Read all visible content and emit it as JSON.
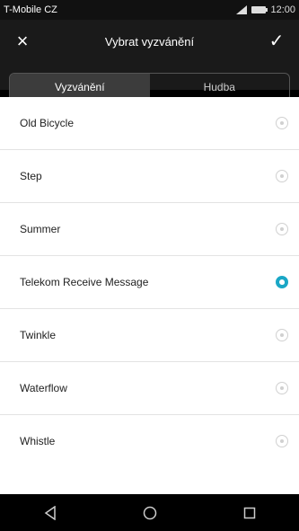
{
  "status_bar": {
    "carrier": "T-Mobile CZ",
    "time": "12:00"
  },
  "header": {
    "title": "Vybrat vyzvánění",
    "close_icon": "×",
    "confirm_icon": "✓"
  },
  "tabs": [
    {
      "label": "Vyzvánění",
      "active": true
    },
    {
      "label": "Hudba",
      "active": false
    }
  ],
  "ringtones": [
    {
      "name": "Old Bicycle",
      "selected": false
    },
    {
      "name": "Step",
      "selected": false
    },
    {
      "name": "Summer",
      "selected": false
    },
    {
      "name": "Telekom Receive Message",
      "selected": true
    },
    {
      "name": "Twinkle",
      "selected": false
    },
    {
      "name": "Waterflow",
      "selected": false
    },
    {
      "name": "Whistle",
      "selected": false
    }
  ],
  "colors": {
    "accent": "#1aa7c6",
    "header_bg": "#1a1a1a"
  }
}
